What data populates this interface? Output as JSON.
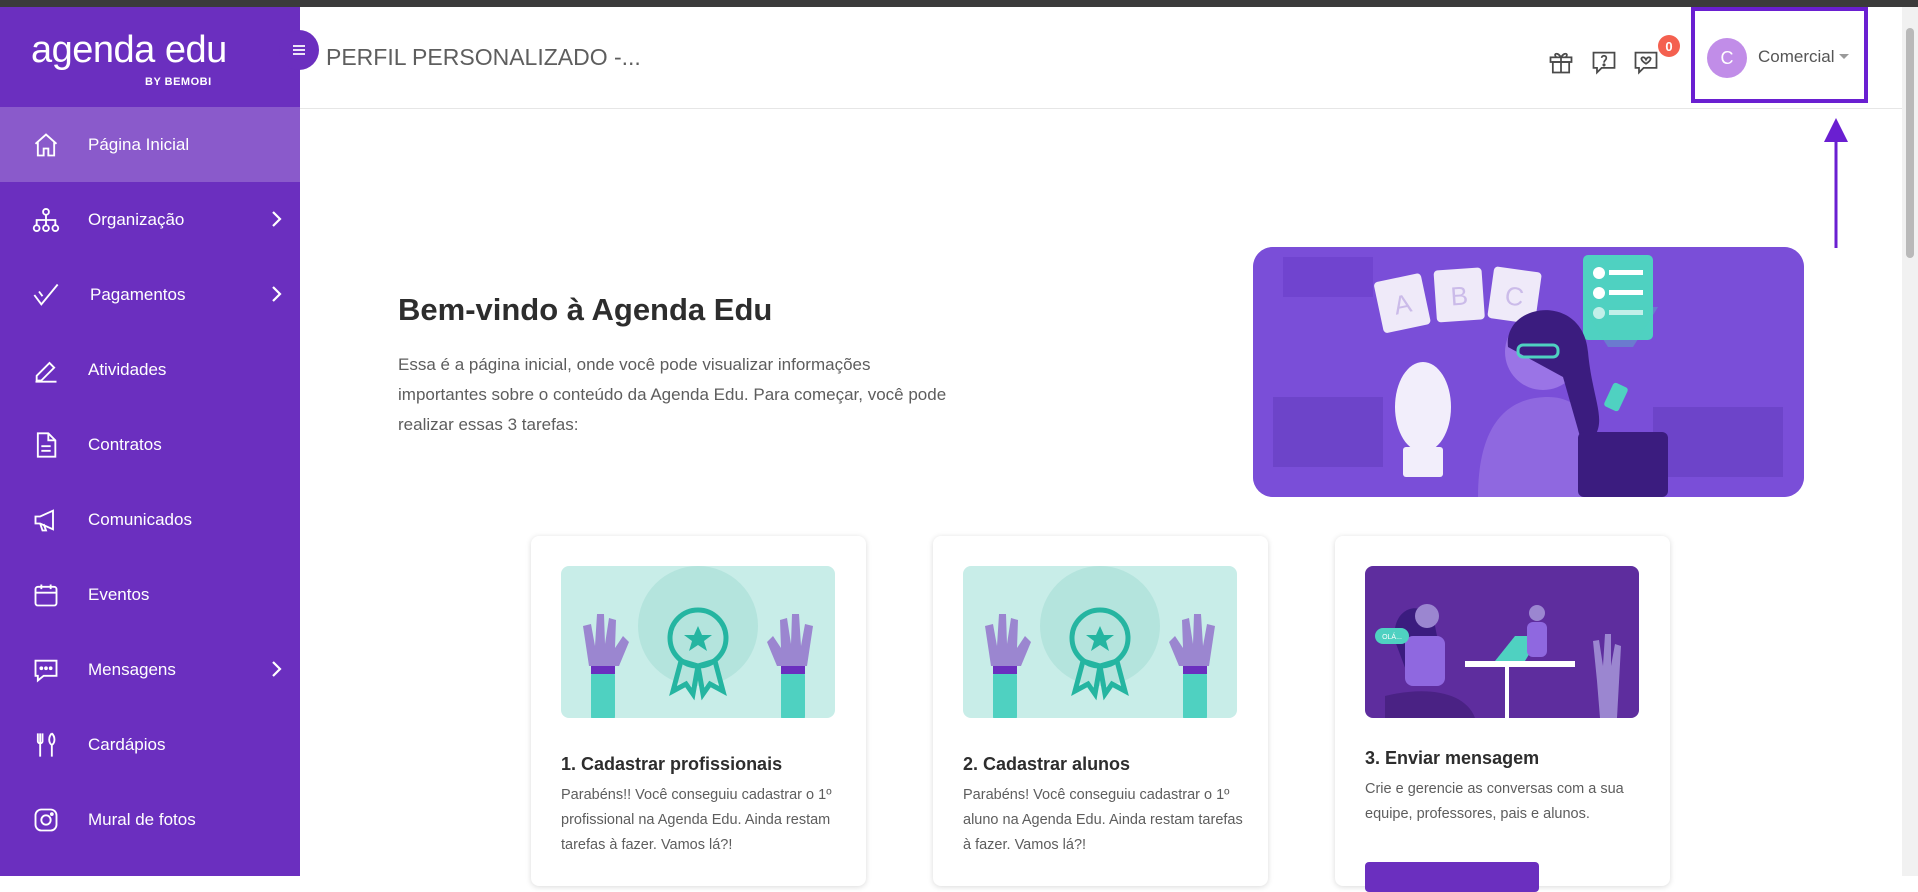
{
  "brand": {
    "name": "agenda edu",
    "sub": "BY BEMOBI"
  },
  "header": {
    "title": "PERFIL PERSONALIZADO -...",
    "notifications_count": "0",
    "user": {
      "initial": "C",
      "name": "Comercial"
    }
  },
  "sidebar": {
    "items": [
      {
        "label": "Página Inicial",
        "icon": "home-icon",
        "active": true
      },
      {
        "label": "Organização",
        "icon": "org-icon",
        "has_submenu": true
      },
      {
        "label": "Pagamentos",
        "icon": "check-icon",
        "has_submenu": true
      },
      {
        "label": "Atividades",
        "icon": "pencil-icon"
      },
      {
        "label": "Contratos",
        "icon": "document-icon"
      },
      {
        "label": "Comunicados",
        "icon": "megaphone-icon"
      },
      {
        "label": "Eventos",
        "icon": "calendar-icon"
      },
      {
        "label": "Mensagens",
        "icon": "chat-icon",
        "has_submenu": true
      },
      {
        "label": "Cardápios",
        "icon": "cutlery-icon"
      },
      {
        "label": "Mural de fotos",
        "icon": "camera-icon"
      }
    ]
  },
  "welcome": {
    "title": "Bem-vindo à Agenda Edu",
    "text": "Essa é a página inicial, onde você pode visualizar informações importantes sobre o conteúdo da Agenda Edu. Para começar, você pode realizar essas 3 tarefas:",
    "hero_letters": [
      "A",
      "B",
      "C"
    ]
  },
  "cards": [
    {
      "title": "1. Cadastrar profissionais",
      "text": "Parabéns!! Você conseguiu cadastrar o 1º profissional na Agenda Edu. Ainda restam tarefas à fazer. Vamos lá?!"
    },
    {
      "title": "2. Cadastrar alunos",
      "text": "Parabéns! Você conseguiu cadastrar o 1º aluno na Agenda Edu. Ainda restam tarefas à fazer. Vamos lá?!"
    },
    {
      "title": "3. Enviar mensagem",
      "text": "Crie e gerencie as conversas com a sua equipe, professores, pais e alunos.",
      "bubble": "OLÁ..."
    }
  ],
  "colors": {
    "sidebar": "#6b2fbf",
    "active": "#8a5acb",
    "highlight": "#6a1fd1",
    "badge": "#f4604f",
    "teal": "#4fd1c1"
  }
}
